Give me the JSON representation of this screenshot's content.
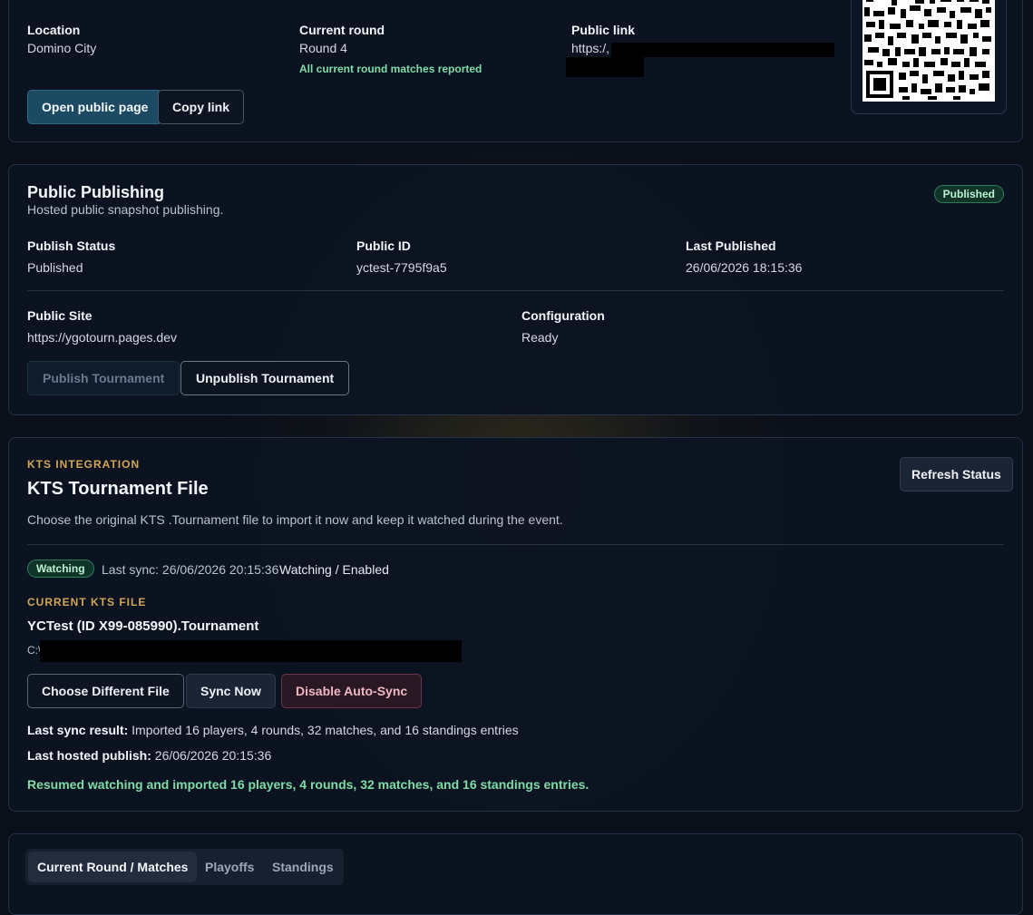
{
  "info_card": {
    "location_label": "Location",
    "location_value": "Domino City",
    "round_label": "Current round",
    "round_value": "Round 4",
    "round_note": "All current round matches reported",
    "public_link_label": "Public link",
    "public_link_value": "https:/,",
    "open_button": "Open public page",
    "copy_button": "Copy link"
  },
  "publishing": {
    "title": "Public Publishing",
    "subtitle": "Hosted public snapshot publishing.",
    "status_badge": "Published",
    "publish_status_label": "Publish Status",
    "publish_status_value": "Published",
    "public_id_label": "Public ID",
    "public_id_value": "yctest-7795f9a5",
    "last_published_label": "Last Published",
    "last_published_value": "26/06/2026 18:15:36",
    "public_site_label": "Public Site",
    "public_site_value": "https://ygotourn.pages.dev",
    "configuration_label": "Configuration",
    "configuration_value": "Ready",
    "publish_button": "Publish Tournament",
    "unpublish_button": "Unpublish Tournament"
  },
  "kts": {
    "eyebrow": "KTS INTEGRATION",
    "title": "KTS Tournament File",
    "description": "Choose the original KTS .Tournament file to import it now and keep it watched during the event.",
    "refresh_button": "Refresh Status",
    "watch_badge": "Watching",
    "last_sync": "Last sync: 26/06/2026 20:15:36",
    "watch_state": "Watching / Enabled",
    "current_file_eyebrow": "CURRENT KTS FILE",
    "file_name": "YCTest (ID X99-085990).Tournament",
    "file_path": "C:\\",
    "choose_button": "Choose Different File",
    "sync_button": "Sync Now",
    "disable_button": "Disable Auto-Sync",
    "last_result_label": "Last sync result:",
    "last_result_value": "Imported 16 players, 4 rounds, 32 matches, and 16 standings entries",
    "last_hosted_label": "Last hosted publish:",
    "last_hosted_value": "26/06/2026 20:15:36",
    "status_message": "Resumed watching and imported 16 players, 4 rounds, 32 matches, and 16 standings entries."
  },
  "tabs": [
    {
      "label": "Current Round / Matches"
    },
    {
      "label": "Playoffs"
    },
    {
      "label": "Standings"
    }
  ],
  "colors": {
    "accent": "#1d4a63",
    "success": "#7fdca6",
    "eyebrow": "#d2a656",
    "danger": "#f0b7c3"
  }
}
